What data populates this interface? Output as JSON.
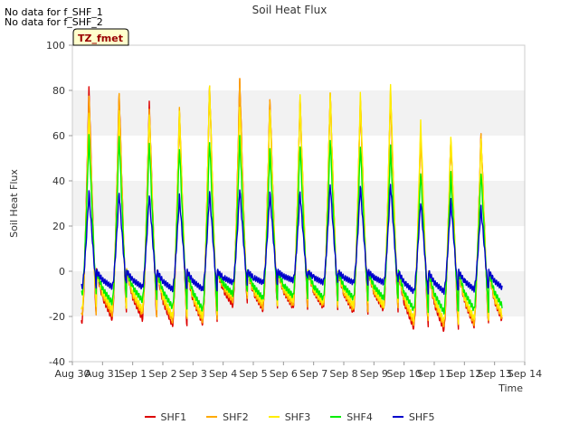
{
  "header": {
    "nodata_1": "No data for f_SHF_1",
    "nodata_2": "No data for f_SHF_2"
  },
  "badge": {
    "label": "TZ_fmet",
    "bg": "#ffffcc",
    "text_color": "#990000"
  },
  "chart_data": {
    "type": "line",
    "title": "Soil Heat Flux",
    "xlabel": "Time",
    "ylabel": "Soil Heat Flux",
    "ylim": [
      -40,
      100
    ],
    "yticks": [
      -40,
      -20,
      0,
      20,
      40,
      60,
      80,
      100
    ],
    "xlim": [
      0,
      15
    ],
    "xtick_labels": [
      "Aug 30",
      "Aug 31",
      "Sep 1",
      "Sep 2",
      "Sep 3",
      "Sep 4",
      "Sep 5",
      "Sep 6",
      "Sep 7",
      "Sep 8",
      "Sep 9",
      "Sep 10",
      "Sep 11",
      "Sep 12",
      "Sep 13",
      "Sep 14"
    ],
    "grid": "horizontal bands",
    "legend_position": "bottom",
    "day_start": 0.3,
    "day_end": 14.25,
    "series": [
      {
        "name": "SHF1",
        "color": "#dd0000",
        "peaks": [
          81,
          79,
          74,
          70,
          82,
          85,
          76,
          76,
          79,
          76,
          78,
          61,
          58,
          60
        ],
        "troughs": [
          -22,
          -21,
          -21,
          -24,
          -23,
          -15,
          -17,
          -16,
          -16,
          -18,
          -17,
          -25,
          -26,
          -24
        ]
      },
      {
        "name": "SHF2",
        "color": "#ffaa00",
        "peaks": [
          78,
          78,
          72,
          72,
          82,
          85,
          76,
          76,
          79,
          76,
          80,
          60,
          58,
          60
        ],
        "troughs": [
          -20,
          -19,
          -19,
          -22,
          -22,
          -13,
          -16,
          -15,
          -15,
          -17,
          -16,
          -23,
          -24,
          -23
        ]
      },
      {
        "name": "SHF3",
        "color": "#ffee00",
        "peaks": [
          71,
          70,
          70,
          70,
          82,
          73,
          72,
          77,
          79,
          78,
          82,
          66,
          60,
          58
        ],
        "troughs": [
          -17,
          -17,
          -17,
          -20,
          -20,
          -11,
          -14,
          -13,
          -14,
          -15,
          -15,
          -21,
          -22,
          -21
        ]
      },
      {
        "name": "SHF4",
        "color": "#00ee00",
        "peaks": [
          60,
          60,
          57,
          55,
          58,
          59,
          54,
          56,
          59,
          56,
          55,
          44,
          43,
          44
        ],
        "troughs": [
          -10,
          -14,
          -13,
          -16,
          -17,
          -10,
          -12,
          -11,
          -12,
          -12,
          -12,
          -17,
          -18,
          -17
        ]
      },
      {
        "name": "SHF5",
        "color": "#0000cc",
        "peaks": [
          35,
          35,
          34,
          33,
          35,
          37,
          35,
          35,
          39,
          38,
          39,
          31,
          31,
          28
        ],
        "troughs": [
          -7,
          -7,
          -7,
          -8,
          -8,
          -5,
          -5,
          -4,
          -5,
          -5,
          -5,
          -9,
          -9,
          -8
        ]
      }
    ]
  }
}
